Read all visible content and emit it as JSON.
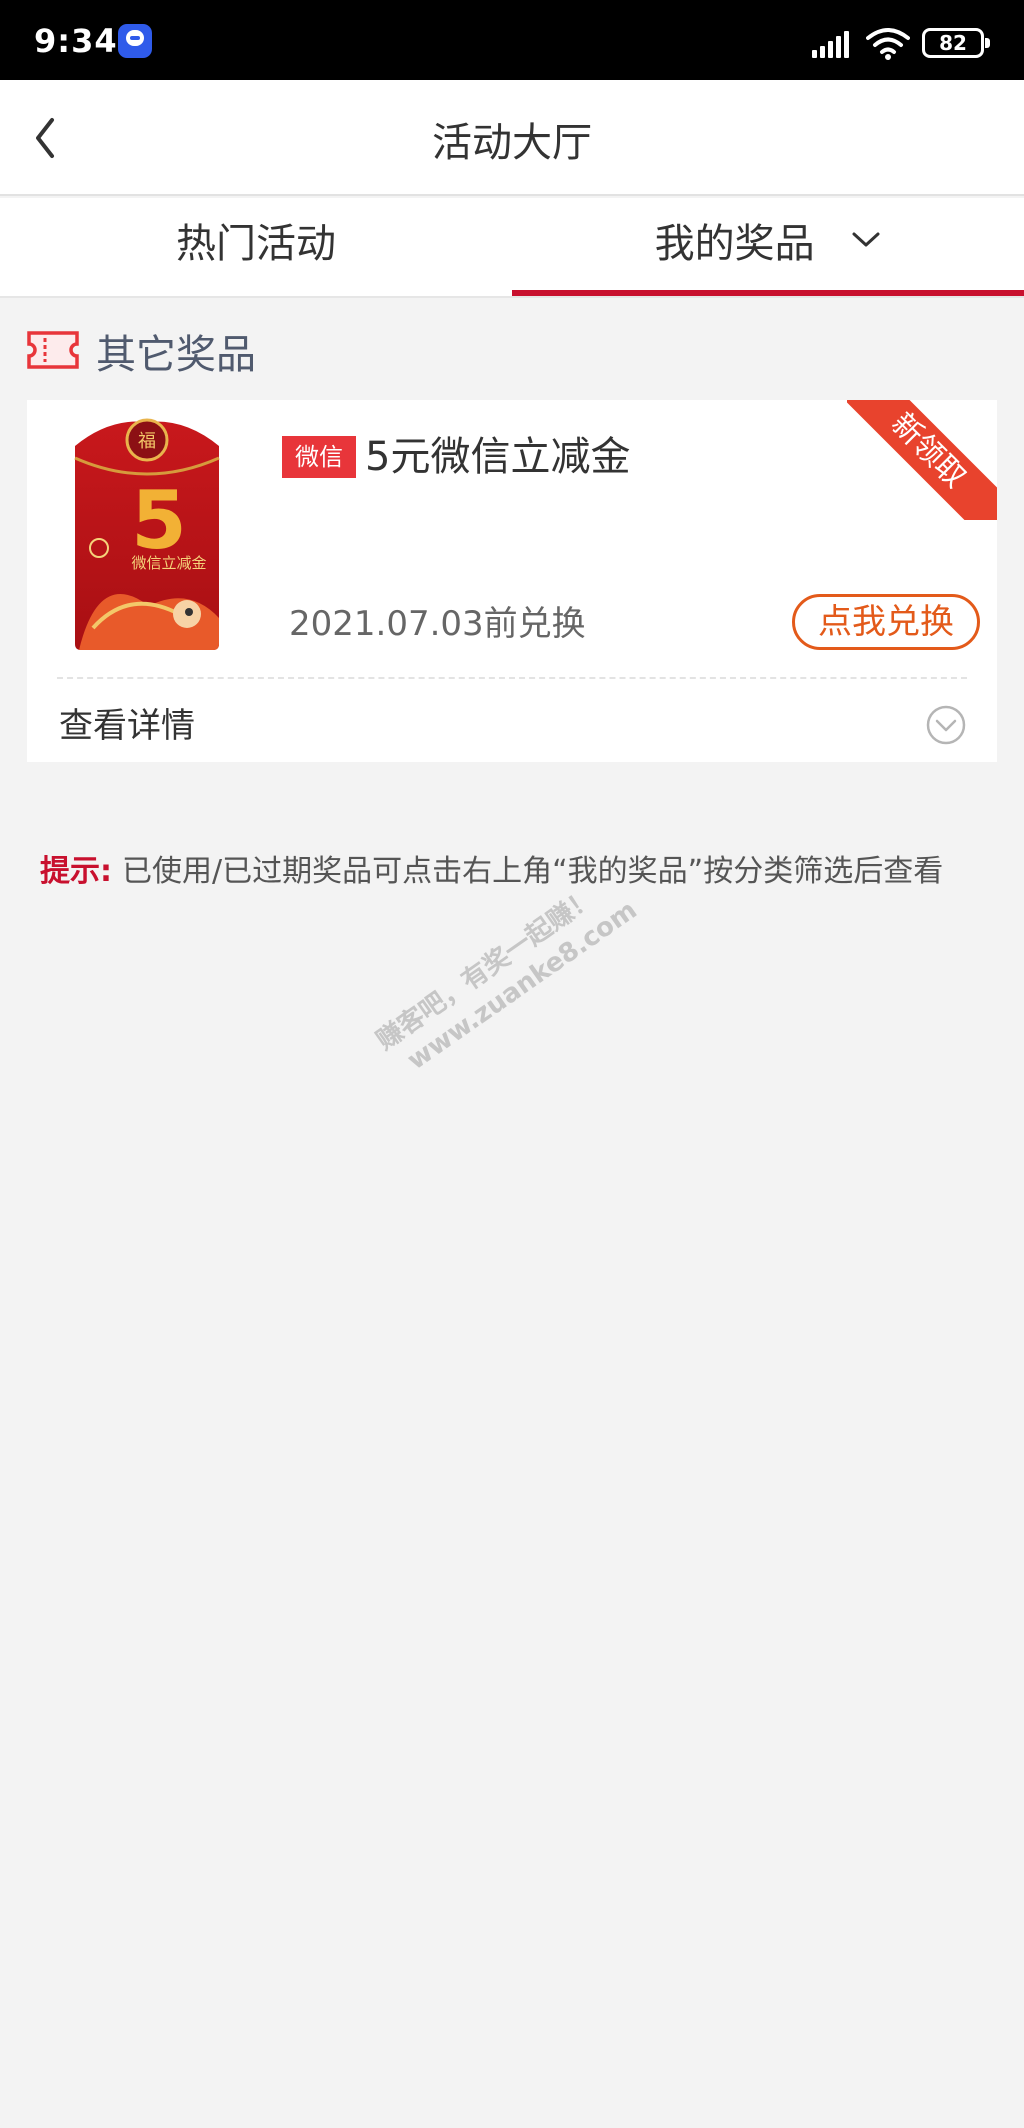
{
  "status_bar": {
    "time": "9:34",
    "battery": "82",
    "icons": [
      "app-badge-icon",
      "signal-icon",
      "wifi-icon",
      "battery-icon"
    ]
  },
  "header": {
    "title": "活动大厅",
    "back_icon": "chevron-left-icon"
  },
  "tabs": [
    {
      "label": "热门活动",
      "active": false
    },
    {
      "label": "我的奖品",
      "active": true,
      "icon": "chevron-down-icon"
    }
  ],
  "colors": {
    "accent": "#c8102e",
    "orange": "#e35a1a",
    "tag_red": "#e8353a",
    "background": "#f3f3f3"
  },
  "section": {
    "title": "其它奖品",
    "icon": "ticket-icon"
  },
  "prize": {
    "tag": "微信",
    "name": "5元微信立减金",
    "ribbon": "新领取",
    "expire": "2021.07.03前兑换",
    "redeem_label": "点我兑换",
    "details_label": "查看详情",
    "details_icon": "chevron-down-circle-icon",
    "image": {
      "amount": "5",
      "caption": "微信立减金"
    }
  },
  "tip": {
    "label": "提示:",
    "text": "已使用/已过期奖品可点击右上角“我的奖品”按分类筛选后查看"
  },
  "watermark": {
    "line1": "赚客吧，有奖一起赚！",
    "line2": "www.zuanke8.com"
  }
}
